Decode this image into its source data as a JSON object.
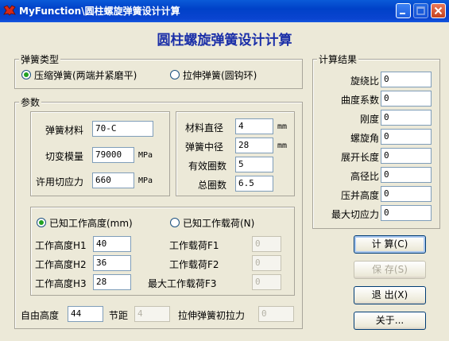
{
  "window": {
    "title": "MyFunction\\圆柱螺旋弹簧设计计算"
  },
  "heading": "圆柱螺旋弹簧设计计算",
  "spring_type": {
    "legend": "弹簧类型",
    "compression_label": "压缩弹簧(两端并紧磨平)",
    "compression_selected": true,
    "tension_label": "拉伸弹簧(圆钩环)",
    "tension_selected": false
  },
  "params": {
    "legend": "参数",
    "material_label": "弹簧材料",
    "material_value": "70-C",
    "shear_modulus_label": "切变模量",
    "shear_modulus_value": "79000",
    "shear_modulus_unit": "MPa",
    "allowable_stress_label": "许用切应力",
    "allowable_stress_value": "660",
    "allowable_stress_unit": "MPa",
    "wire_diameter_label": "材料直径",
    "wire_diameter_value": "4",
    "wire_diameter_unit": "mm",
    "mean_diameter_label": "弹簧中径",
    "mean_diameter_value": "28",
    "mean_diameter_unit": "mm",
    "active_coils_label": "有效圈数",
    "active_coils_value": "5",
    "total_coils_label": "总圈数",
    "total_coils_value": "6.5"
  },
  "load_mode": {
    "known_height_label": "已知工作高度(mm)",
    "known_height_selected": true,
    "known_load_label": "已知工作载荷(N)",
    "known_load_selected": false,
    "h1_label": "工作高度H1",
    "h1_value": "40",
    "h2_label": "工作高度H2",
    "h2_value": "36",
    "h3_label": "工作高度H3",
    "h3_value": "28",
    "f1_label": "工作载荷F1",
    "f1_value": "0",
    "f2_label": "工作载荷F2",
    "f2_value": "0",
    "f3_label": "最大工作载荷F3",
    "f3_value": "0"
  },
  "bottom": {
    "free_height_label": "自由高度",
    "free_height_value": "44",
    "pitch_label": "节距",
    "pitch_value": "4",
    "initial_tension_label": "拉伸弹簧初拉力",
    "initial_tension_value": "0"
  },
  "results": {
    "legend": "计算结果",
    "items": [
      {
        "label": "旋绕比",
        "value": "0"
      },
      {
        "label": "曲度系数",
        "value": "0"
      },
      {
        "label": "刚度",
        "value": "0"
      },
      {
        "label": "螺旋角",
        "value": "0"
      },
      {
        "label": "展开长度",
        "value": "0"
      },
      {
        "label": "高径比",
        "value": "0"
      },
      {
        "label": "压并高度",
        "value": "0"
      },
      {
        "label": "最大切应力",
        "value": "0"
      }
    ]
  },
  "buttons": {
    "calculate": "计 算(C)",
    "save": "保 存(S)",
    "exit": "退 出(X)",
    "about": "关于..."
  },
  "colors": {
    "title_bar": "#0a44d0",
    "heading": "#1b2fa8",
    "face": "#ece9d8"
  }
}
